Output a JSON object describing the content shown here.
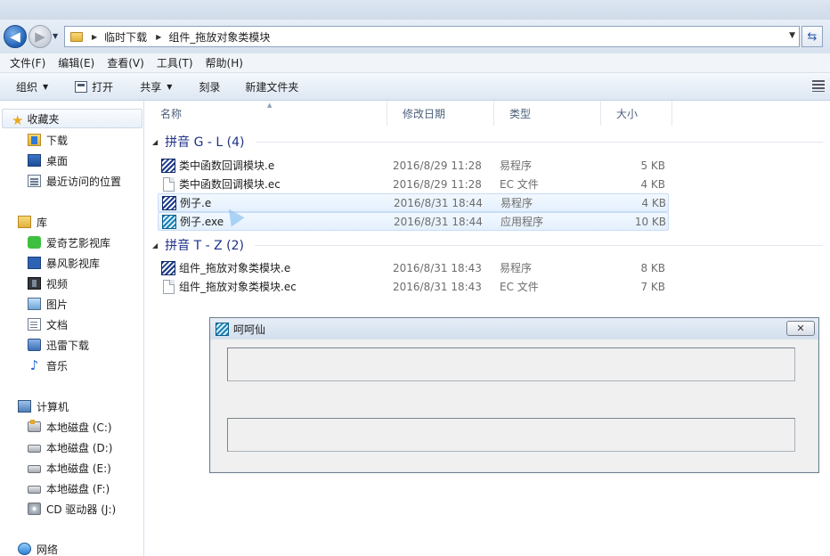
{
  "address": {
    "crumbs": [
      "临时下载",
      "组件_拖放对象类模块"
    ]
  },
  "menu": [
    "文件(F)",
    "编辑(E)",
    "查看(V)",
    "工具(T)",
    "帮助(H)"
  ],
  "toolbar": {
    "organize": "组织",
    "open": "打开",
    "share": "共享",
    "burn": "刻录",
    "new_folder": "新建文件夹"
  },
  "nav": {
    "favorites": "收藏夹",
    "downloads": "下载",
    "desktop": "桌面",
    "recent": "最近访问的位置",
    "libraries": "库",
    "iqiyi": "爱奇艺影视库",
    "storm": "暴风影视库",
    "videos": "视频",
    "pictures": "图片",
    "documents": "文档",
    "xunlei": "迅雷下载",
    "music": "音乐",
    "computer": "计算机",
    "disk_c": "本地磁盘 (C:)",
    "disk_d": "本地磁盘 (D:)",
    "disk_e": "本地磁盘 (E:)",
    "disk_f": "本地磁盘 (F:)",
    "cd": "CD 驱动器 (J:)",
    "network": "网络"
  },
  "columns": {
    "name": "名称",
    "date": "修改日期",
    "type": "类型",
    "size": "大小"
  },
  "groups": [
    {
      "title": "拼音 G - L (4)",
      "files": [
        {
          "name": "类中函数回调模块.e",
          "date": "2016/8/29 11:28",
          "type": "易程序",
          "size": "5 KB"
        },
        {
          "name": "类中函数回调模块.ec",
          "date": "2016/8/29 11:28",
          "type": "EC 文件",
          "size": "4 KB"
        },
        {
          "name": "例子.e",
          "date": "2016/8/31 18:44",
          "type": "易程序",
          "size": "4 KB"
        },
        {
          "name": "例子.exe",
          "date": "2016/8/31 18:44",
          "type": "应用程序",
          "size": "10 KB"
        }
      ]
    },
    {
      "title": "拼音 T - Z (2)",
      "files": [
        {
          "name": "组件_拖放对象类模块.e",
          "date": "2016/8/31 18:43",
          "type": "易程序",
          "size": "8 KB"
        },
        {
          "name": "组件_拖放对象类模块.ec",
          "date": "2016/8/31 18:43",
          "type": "EC 文件",
          "size": "7 KB"
        }
      ]
    }
  ],
  "dialog": {
    "title": "呵呵仙",
    "close": "✕"
  }
}
